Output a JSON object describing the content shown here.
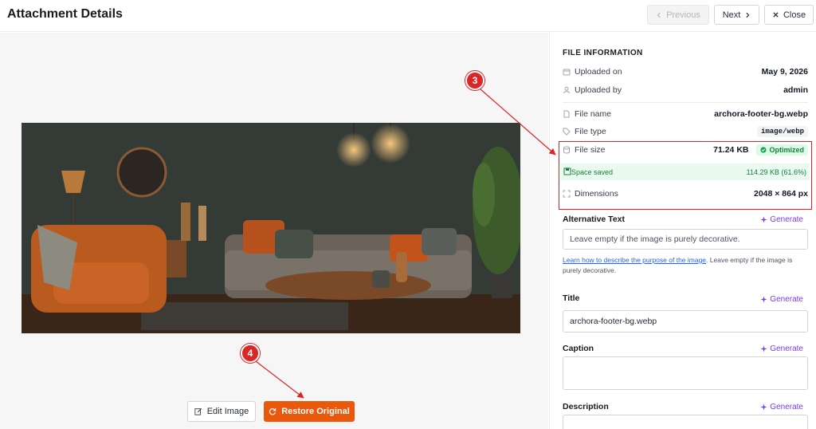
{
  "header": {
    "title": "Attachment Details",
    "previous_label": "Previous",
    "next_label": "Next",
    "close_label": "Close"
  },
  "preview": {
    "image_alt": "archora-footer-bg.webp",
    "edit_label": "Edit Image",
    "restore_label": "Restore Original"
  },
  "callouts": {
    "three": "3",
    "four": "4"
  },
  "file_info": {
    "section_title": "FILE INFORMATION",
    "uploaded_on_label": "Uploaded on",
    "uploaded_on_value": "May 9, 2026",
    "uploaded_by_label": "Uploaded by",
    "uploaded_by_value": "admin",
    "file_name_label": "File name",
    "file_name_value": "archora-footer-bg.webp",
    "file_type_label": "File type",
    "file_type_value": "image/webp",
    "file_size_label": "File size",
    "file_size_value": "71.24 KB",
    "optimized_badge": "Optimized",
    "space_saved_label": "Space saved",
    "space_saved_value": "114.29 KB (61.6%)",
    "dimensions_label": "Dimensions",
    "dimensions_value": "2048 × 864 px"
  },
  "fields": {
    "generate_label": "Generate",
    "alt_text": {
      "label": "Alternative Text",
      "placeholder": "Leave empty if the image is purely decorative.",
      "help_link": "Learn how to describe the purpose of the image",
      "help_text": ". Leave empty if the image is purely decorative."
    },
    "title": {
      "label": "Title",
      "value": "archora-footer-bg.webp"
    },
    "caption": {
      "label": "Caption",
      "value": ""
    },
    "description": {
      "label": "Description",
      "value": ""
    }
  },
  "colors": {
    "accent_orange": "#ea580c",
    "annotation_red": "#dc2626",
    "generate_purple": "#7c3aed",
    "optimized_green": "#15803d"
  }
}
